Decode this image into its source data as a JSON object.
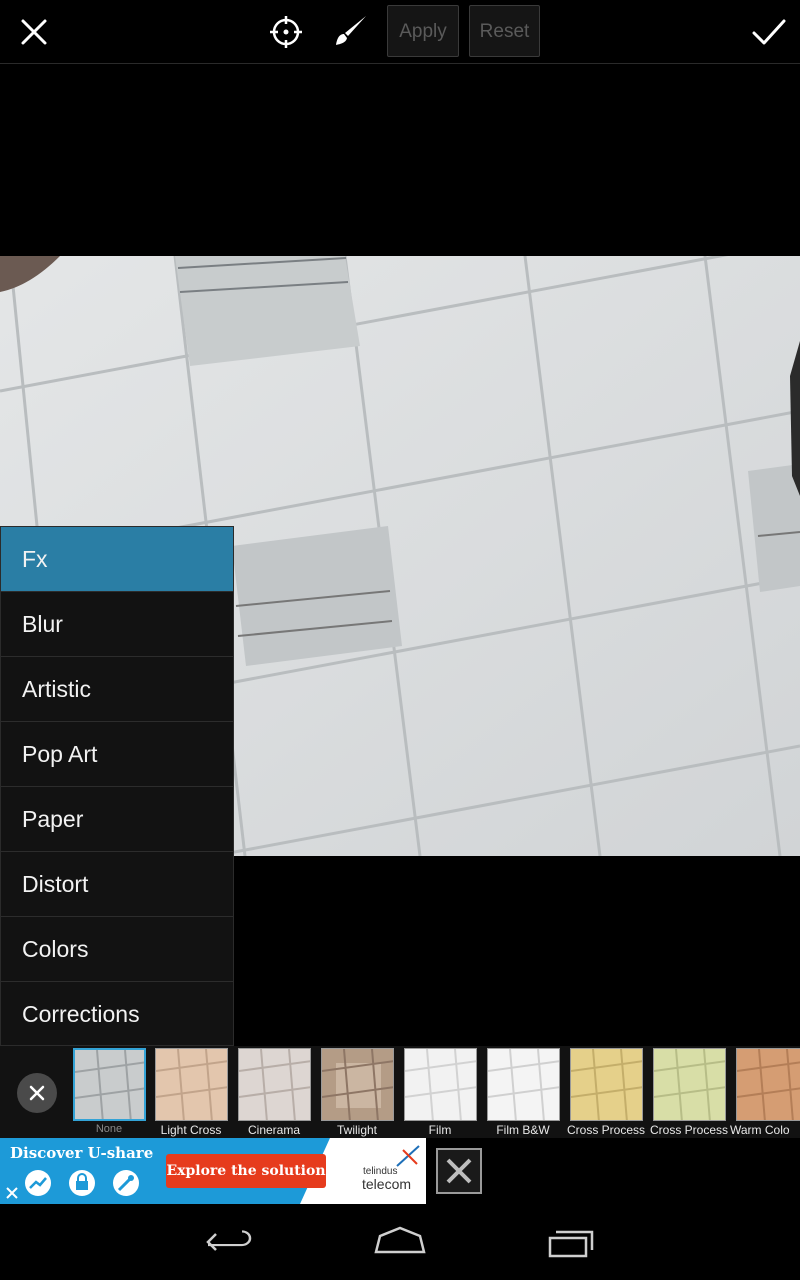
{
  "toolbar": {
    "apply_label": "Apply",
    "reset_label": "Reset",
    "icons": [
      "close-icon",
      "target-icon",
      "brush-icon",
      "check-icon"
    ]
  },
  "menu": {
    "items": [
      {
        "label": "Fx",
        "active": true
      },
      {
        "label": "Blur"
      },
      {
        "label": "Artistic"
      },
      {
        "label": "Pop Art"
      },
      {
        "label": "Paper"
      },
      {
        "label": "Distort"
      },
      {
        "label": "Colors"
      },
      {
        "label": "Corrections"
      }
    ]
  },
  "effects": [
    {
      "label": "None",
      "tint": "#c9cccd",
      "selected": true
    },
    {
      "label": "Light Cross",
      "tint": "#e3c6ad"
    },
    {
      "label": "Cinerama",
      "tint": "#ddd6d2"
    },
    {
      "label": "Twilight",
      "tint": "#b49c86"
    },
    {
      "label": "Film",
      "tint": "#f2f2f2"
    },
    {
      "label": "Film B&W",
      "tint": "#f4f4f4"
    },
    {
      "label": "Cross Process",
      "tint": "#e5d08a"
    },
    {
      "label": "Cross Process",
      "tint": "#d8dea7"
    },
    {
      "label": "Warm Colo",
      "tint": "#d59d73"
    }
  ],
  "ad": {
    "title": "Discover U-share",
    "cta": "Explore the solution",
    "brand_line1": "telindus",
    "brand_line2": "telecom"
  },
  "colors": {
    "accent": "#2a7ea5",
    "selected_border": "#33a3d6",
    "ad_blue": "#1d9ad8",
    "ad_cta": "#e63b1d"
  }
}
